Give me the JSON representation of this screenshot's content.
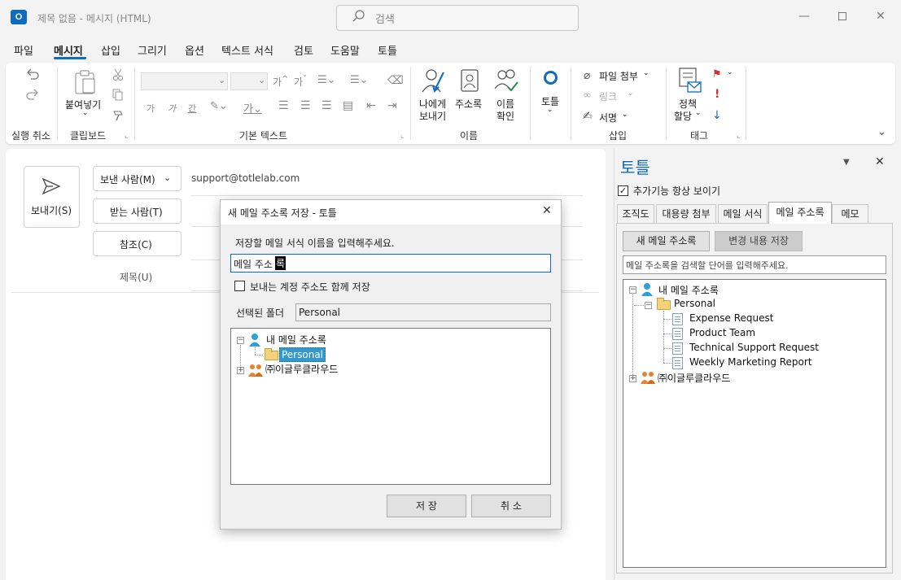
{
  "window": {
    "title": "제목 없음 - 메시지 (HTML)",
    "app_icon_letter": "O",
    "search_placeholder": "검색"
  },
  "menu": [
    "파일",
    "메시지",
    "삽입",
    "그리기",
    "옵션",
    "텍스트 서식",
    "검토",
    "도움말",
    "토틀"
  ],
  "ribbon": {
    "groups": {
      "undo": "실행 취소",
      "clipboard": "클립보드",
      "basic_text": "기본 텍스트",
      "names": "이름",
      "insert": "삽입",
      "tags": "태그"
    },
    "paste": "붙여넣기",
    "send_to_me": [
      "나에게",
      "보내기"
    ],
    "address_book": "주소록",
    "check_names": [
      "이름",
      "확인"
    ],
    "totle": "토틀",
    "attach_file": "파일 첨부",
    "link": "링크",
    "signature": "서명",
    "policy": [
      "정책",
      "할당"
    ],
    "font_small": [
      "가",
      "가",
      "간"
    ]
  },
  "compose": {
    "send_button": "보내기(S)",
    "from_button": "보낸 사람(M)",
    "from_value": "support@totlelab.com",
    "to_button": "받는 사람(T)",
    "cc_button": "참조(C)",
    "subject_label": "제목(U)"
  },
  "panel": {
    "title": "토틀",
    "always_show_label": "추가기능 항상 보이기",
    "always_show_checked": true,
    "tabs": [
      "조직도",
      "대용량 첨부",
      "메일 서식",
      "메일 주소록",
      "메모"
    ],
    "active_tab": "메일 주소록",
    "new_button": "새 메일 주소록",
    "save_changes_button": "변경 내용 저장",
    "search_placeholder": "메일 주소록을 검색할 단어를 입력해주세요.",
    "tree": {
      "root": "내 메일 주소록",
      "folder": "Personal",
      "items": [
        "Expense Request",
        "Product Team",
        "Technical Support Request",
        "Weekly Marketing Report"
      ],
      "org": "㈜이글루클라우드"
    }
  },
  "dialog": {
    "title": "새 메일 주소록 저장 - 토틀",
    "prompt": "저장할 메일 서식 이름을 입력해주세요.",
    "name_value": "메일 주소",
    "name_cursor_char": "록",
    "save_sender_label": "보내는 계정 주소도 함께 저장",
    "save_sender_checked": false,
    "selected_folder_label": "선택된 폴더",
    "selected_folder_value": "Personal",
    "tree": {
      "root": "내 메일 주소록",
      "folder": "Personal",
      "org": "㈜이글루클라우드"
    },
    "save_button": "저 장",
    "cancel_button": "취 소"
  },
  "colors": {
    "accent": "#0f6cbd",
    "selection": "#3399cc",
    "flag": "#d13438"
  }
}
